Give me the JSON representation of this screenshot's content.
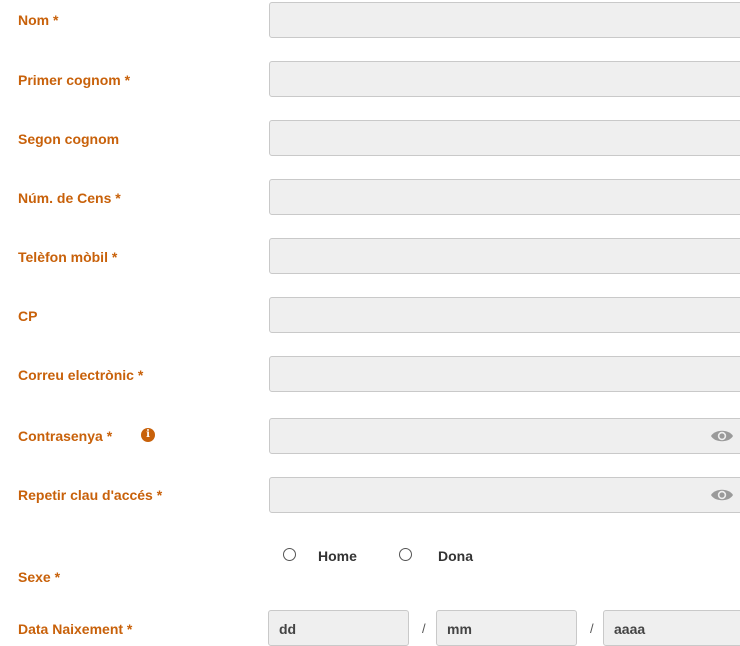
{
  "form": {
    "fields": [
      {
        "label": "Nom *",
        "value": ""
      },
      {
        "label": "Primer cognom *",
        "value": ""
      },
      {
        "label": "Segon cognom",
        "value": ""
      },
      {
        "label": "Núm. de Cens *",
        "value": ""
      },
      {
        "label": "Telèfon mòbil *",
        "value": ""
      },
      {
        "label": "CP",
        "value": ""
      },
      {
        "label": "Correu electrònic *",
        "value": ""
      },
      {
        "label": "Contrasenya *",
        "value": ""
      },
      {
        "label": "Repetir clau d'accés *",
        "value": ""
      }
    ],
    "sex": {
      "label": "Sexe *",
      "options": [
        "Home",
        "Dona"
      ],
      "selected": null
    },
    "birth_date": {
      "label": "Data Naixement *",
      "day_placeholder": "dd",
      "month_placeholder": "mm",
      "year_placeholder": "aaaa",
      "separator": "/"
    },
    "icons": {
      "info": "info-circle-icon",
      "eye": "eye-icon",
      "accent_color": "#c8610a"
    }
  }
}
